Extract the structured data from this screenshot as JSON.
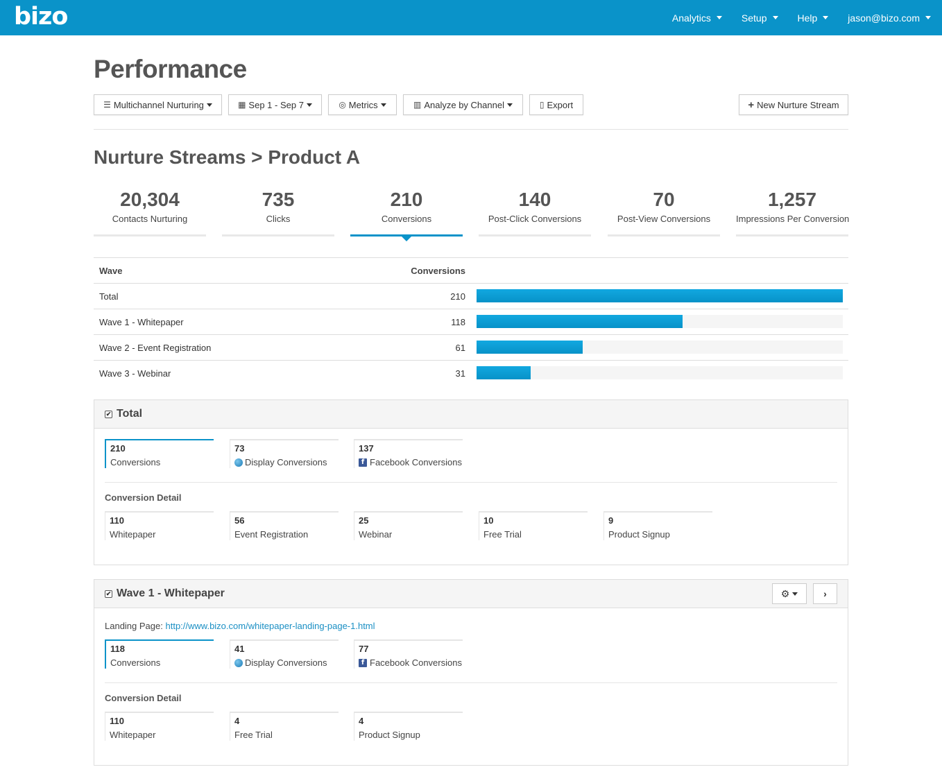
{
  "app": {
    "logo": "bizo"
  },
  "nav": [
    {
      "label": "Analytics"
    },
    {
      "label": "Setup"
    },
    {
      "label": "Help"
    },
    {
      "label": "jason@bizo.com"
    }
  ],
  "page_title": "Performance",
  "toolbar": {
    "nurturing": "Multichannel Nurturing",
    "date": "Sep 1 - Sep 7",
    "metrics": "Metrics",
    "analyze": "Analyze by Channel",
    "export": "Export",
    "new_stream": "New Nurture Stream"
  },
  "section_title": "Nurture Streams > Product A",
  "stats": [
    {
      "value": "20,304",
      "label": "Contacts Nurturing"
    },
    {
      "value": "735",
      "label": "Clicks"
    },
    {
      "value": "210",
      "label": "Conversions"
    },
    {
      "value": "140",
      "label": "Post-Click Conversions"
    },
    {
      "value": "70",
      "label": "Post-View Conversions"
    },
    {
      "value": "1,257",
      "label": "Impressions Per Conversion"
    }
  ],
  "table": {
    "col_wave": "Wave",
    "col_conv": "Conversions",
    "rows": [
      {
        "name": "Total",
        "value": "210",
        "fraction": 1.0
      },
      {
        "name": "Wave 1 - Whitepaper",
        "value": "118",
        "fraction": 0.562
      },
      {
        "name": "Wave 2 - Event Registration",
        "value": "61",
        "fraction": 0.29
      },
      {
        "name": "Wave 3 - Webinar",
        "value": "31",
        "fraction": 0.148
      }
    ]
  },
  "panel_total": {
    "title": "Total",
    "summary": [
      {
        "value": "210",
        "label": "Conversions"
      },
      {
        "value": "73",
        "label": "Display Conversions"
      },
      {
        "value": "137",
        "label": "Facebook Conversions"
      }
    ],
    "detail_label": "Conversion Detail",
    "detail": [
      {
        "value": "110",
        "label": "Whitepaper"
      },
      {
        "value": "56",
        "label": "Event Registration"
      },
      {
        "value": "25",
        "label": "Webinar"
      },
      {
        "value": "10",
        "label": "Free Trial"
      },
      {
        "value": "9",
        "label": "Product Signup"
      }
    ]
  },
  "panel_wave1": {
    "title": "Wave 1 - Whitepaper",
    "landing_label": "Landing Page:",
    "landing_url": "http://www.bizo.com/whitepaper-landing-page-1.html",
    "summary": [
      {
        "value": "118",
        "label": "Conversions"
      },
      {
        "value": "41",
        "label": "Display Conversions"
      },
      {
        "value": "77",
        "label": "Facebook Conversions"
      }
    ],
    "detail_label": "Conversion Detail",
    "detail": [
      {
        "value": "110",
        "label": "Whitepaper"
      },
      {
        "value": "4",
        "label": "Free Trial"
      },
      {
        "value": "4",
        "label": "Product Signup"
      }
    ]
  },
  "colors": {
    "accent": "#0a93c9",
    "facebook": "#3b5998"
  }
}
